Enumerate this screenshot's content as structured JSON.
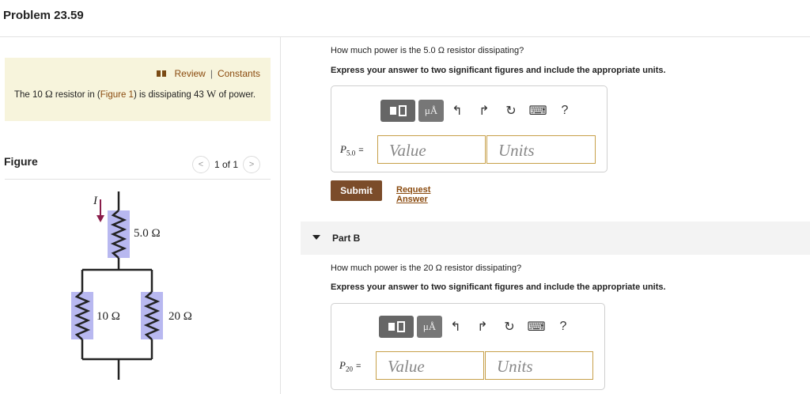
{
  "header": {
    "title": "Problem 23.59"
  },
  "info": {
    "review": "Review",
    "separator": "|",
    "constants": "Constants",
    "text_1": "The 10 ",
    "ohm": "Ω",
    "text_2": " resistor in (",
    "figure_link": "Figure 1",
    "text_3": ") is dissipating 43 ",
    "watt": "W",
    "text_4": " of power."
  },
  "figure": {
    "label": "Figure",
    "pager_text": "1 of 1",
    "prev": "<",
    "next": ">",
    "current_label": "I",
    "r_top": "5.0 Ω",
    "r_left": "10 Ω",
    "r_right": "20 Ω"
  },
  "part_a": {
    "question": "How much power is the 5.0 Ω resistor dissipating?",
    "instructions": "Express your answer to two significant figures and include the appropriate units.",
    "var_name": "P",
    "var_sub": "5.0",
    "equals": "=",
    "value_placeholder": "Value",
    "units_placeholder": "Units",
    "submit": "Submit",
    "request_answer": "Request Answer"
  },
  "part_b": {
    "title": "Part B",
    "question": "How much power is the 20 Ω resistor dissipating?",
    "instructions": "Express your answer to two significant figures and include the appropriate units.",
    "var_name": "P",
    "var_sub": "20",
    "equals": "=",
    "value_placeholder": "Value",
    "units_placeholder": "Units"
  },
  "toolbar": {
    "mu_label": "μÅ",
    "undo": "↰",
    "redo": "↱",
    "reset": "↻",
    "keyboard": "⌨",
    "help": "?"
  },
  "colors": {
    "accent": "#8a4a0e",
    "submit_bg": "#7b4c2a",
    "info_bg": "#f7f4dc",
    "resistor": "#b8b8f0",
    "arrow": "#8a1d4a"
  }
}
